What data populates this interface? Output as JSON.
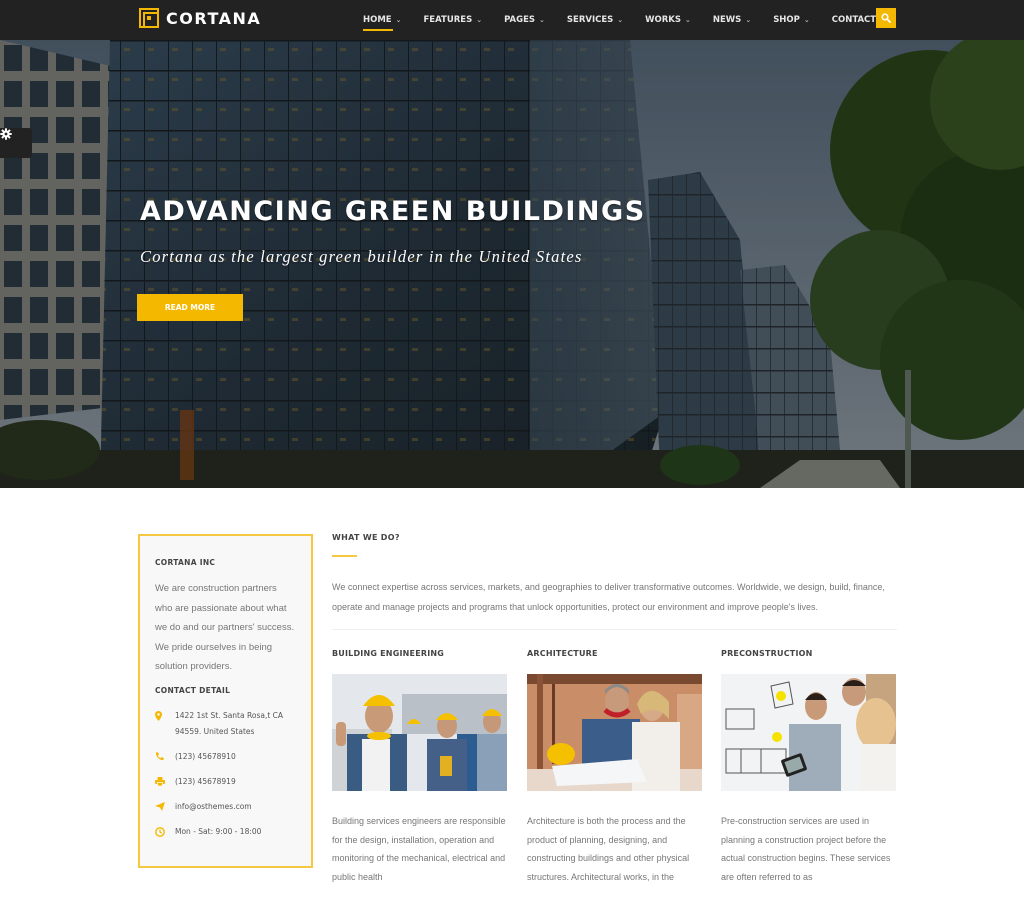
{
  "brand": {
    "name": "CORTANA",
    "accent": "#f5b800"
  },
  "nav": {
    "items": [
      {
        "label": "HOME",
        "dropdown": true,
        "active": true
      },
      {
        "label": "FEATURES",
        "dropdown": true
      },
      {
        "label": "PAGES",
        "dropdown": true
      },
      {
        "label": "SERVICES",
        "dropdown": true
      },
      {
        "label": "WORKS",
        "dropdown": true
      },
      {
        "label": "NEWS",
        "dropdown": true
      },
      {
        "label": "SHOP",
        "dropdown": true
      },
      {
        "label": "CONTACT US",
        "dropdown": false
      }
    ],
    "search_icon": "search-icon"
  },
  "settings": {
    "icon": "gear-icon"
  },
  "hero": {
    "title": "ADVANCING GREEN BUILDINGS",
    "subtitle": "Cortana as the largest green builder in the United States",
    "button_label": "READ MORE"
  },
  "sidebar": {
    "company_heading": "CORTANA INC",
    "about": "We are construction partners who are passionate about what we do and our partners' success. We pride ourselves in being solution providers.",
    "contact_heading": "CONTACT DETAIL",
    "contacts": [
      {
        "icon": "map-pin-icon",
        "text": "1422 1st St. Santa Rosa,t CA 94559. United States"
      },
      {
        "icon": "phone-icon",
        "text": "(123) 45678910"
      },
      {
        "icon": "fax-icon",
        "text": "(123) 45678919"
      },
      {
        "icon": "send-icon",
        "text": "info@osthemes.com"
      },
      {
        "icon": "clock-icon",
        "text": "Mon - Sat: 9:00 - 18:00"
      }
    ]
  },
  "main": {
    "heading": "WHAT WE DO?",
    "intro": "We connect expertise across services, markets, and geographies to deliver transformative outcomes. Worldwide, we design, build, finance, operate and manage projects and programs that unlock opportunities, protect our environment and improve people's lives.",
    "services": [
      {
        "title": "BUILDING ENGINEERING",
        "image": "construction workers in hard hats giving thumbs up",
        "text": "Building services engineers are responsible for the design, installation, operation and monitoring of the mechanical, electrical and public health"
      },
      {
        "title": "ARCHITECTURE",
        "image": "architects reviewing blueprints on site",
        "text": "Architecture is both the process and the product of planning, designing, and constructing buildings and other physical structures. Architectural works, in the"
      },
      {
        "title": "PRECONSTRUCTION",
        "image": "team reviewing floor plans on whiteboard with tablet",
        "text": "Pre-construction services are used in planning a construction project before the actual construction begins. These services are often referred to as"
      }
    ]
  }
}
